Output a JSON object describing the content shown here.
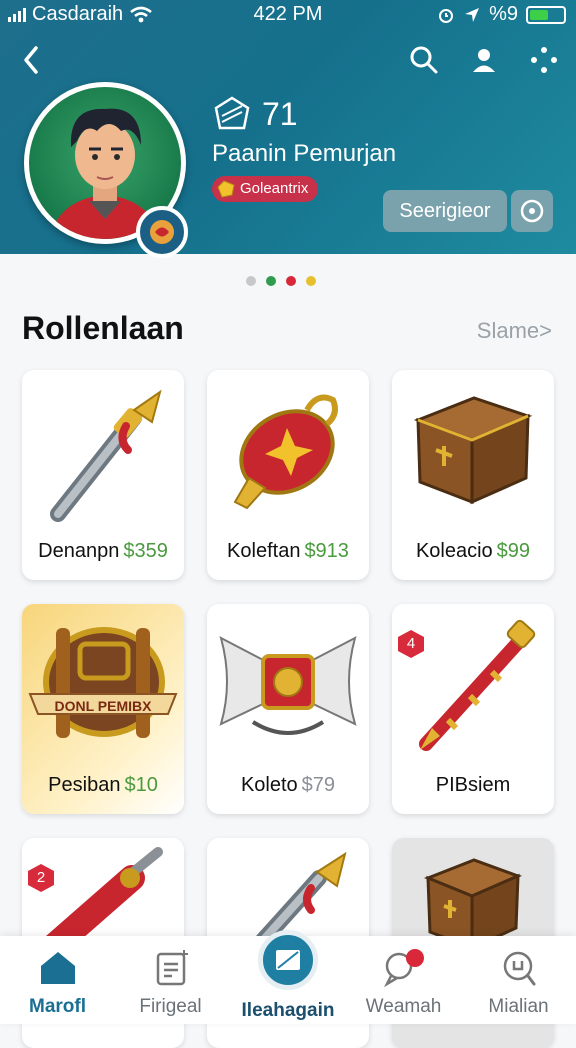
{
  "status_bar": {
    "carrier": "Casdaraih",
    "time": "422 PM",
    "right_text": "%9",
    "battery_level": 0.55
  },
  "header": {
    "level": "71",
    "player_name": "Paanin Pemurjan",
    "rank_label": "Goleantrix",
    "action_button": "Seerigieor",
    "icons": [
      "back-icon",
      "search-icon",
      "profile-icon",
      "more-icon"
    ]
  },
  "pager": {
    "dot_colors": [
      "#c8c8c8",
      "#2e9b4d",
      "#d8283a",
      "#e7c030"
    ],
    "active_index": 2
  },
  "section": {
    "title": "Rollenlaan",
    "more_label": "Slame>"
  },
  "items": [
    {
      "name": "Denanpn",
      "price": "$359",
      "art": "pickaxe"
    },
    {
      "name": "Koleftan",
      "price": "$913",
      "art": "red-lantern"
    },
    {
      "name": "Koleacio",
      "price": "$99",
      "art": "wooden-crate"
    },
    {
      "name": "Pesiban",
      "price": "$10",
      "art": "treasure-chest",
      "banner": "DONL PEMIBX"
    },
    {
      "name": "Koleto",
      "price": "$79",
      "art": "scroll-bow"
    },
    {
      "name": "PIBsiem",
      "price": "",
      "art": "golden-wand",
      "badge": "4"
    },
    {
      "name": "",
      "price": "",
      "art": "red-lance",
      "badge": "2"
    },
    {
      "name": "",
      "price": "",
      "art": "pickaxe"
    },
    {
      "name": "",
      "price": "",
      "art": "wooden-crate"
    }
  ],
  "tabbar": {
    "tabs": [
      {
        "label": "Marofl",
        "icon": "home-icon"
      },
      {
        "label": "Firigeal",
        "icon": "clipboard-icon"
      },
      {
        "label": "Ileahagain",
        "icon": "center-action-icon"
      },
      {
        "label": "Weamah",
        "icon": "chat-icon"
      },
      {
        "label": "Mialian",
        "icon": "search-icon"
      }
    ],
    "active_index": 0
  },
  "colors": {
    "header": "#15708c",
    "accent_green": "#4a9a3e",
    "tab_active": "#1b6f93",
    "rank_badge": "#c8314a"
  }
}
